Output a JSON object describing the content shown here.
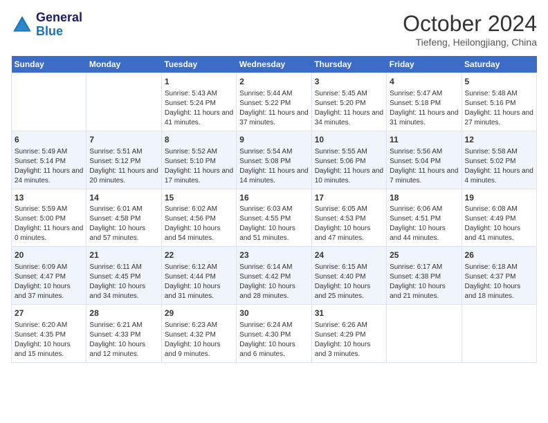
{
  "header": {
    "logo_line1": "General",
    "logo_line2": "Blue",
    "month": "October 2024",
    "location": "Tiefeng, Heilongjiang, China"
  },
  "weekdays": [
    "Sunday",
    "Monday",
    "Tuesday",
    "Wednesday",
    "Thursday",
    "Friday",
    "Saturday"
  ],
  "rows": [
    [
      {
        "day": "",
        "content": ""
      },
      {
        "day": "",
        "content": ""
      },
      {
        "day": "1",
        "content": "Sunrise: 5:43 AM\nSunset: 5:24 PM\nDaylight: 11 hours and 41 minutes."
      },
      {
        "day": "2",
        "content": "Sunrise: 5:44 AM\nSunset: 5:22 PM\nDaylight: 11 hours and 37 minutes."
      },
      {
        "day": "3",
        "content": "Sunrise: 5:45 AM\nSunset: 5:20 PM\nDaylight: 11 hours and 34 minutes."
      },
      {
        "day": "4",
        "content": "Sunrise: 5:47 AM\nSunset: 5:18 PM\nDaylight: 11 hours and 31 minutes."
      },
      {
        "day": "5",
        "content": "Sunrise: 5:48 AM\nSunset: 5:16 PM\nDaylight: 11 hours and 27 minutes."
      }
    ],
    [
      {
        "day": "6",
        "content": "Sunrise: 5:49 AM\nSunset: 5:14 PM\nDaylight: 11 hours and 24 minutes."
      },
      {
        "day": "7",
        "content": "Sunrise: 5:51 AM\nSunset: 5:12 PM\nDaylight: 11 hours and 20 minutes."
      },
      {
        "day": "8",
        "content": "Sunrise: 5:52 AM\nSunset: 5:10 PM\nDaylight: 11 hours and 17 minutes."
      },
      {
        "day": "9",
        "content": "Sunrise: 5:54 AM\nSunset: 5:08 PM\nDaylight: 11 hours and 14 minutes."
      },
      {
        "day": "10",
        "content": "Sunrise: 5:55 AM\nSunset: 5:06 PM\nDaylight: 11 hours and 10 minutes."
      },
      {
        "day": "11",
        "content": "Sunrise: 5:56 AM\nSunset: 5:04 PM\nDaylight: 11 hours and 7 minutes."
      },
      {
        "day": "12",
        "content": "Sunrise: 5:58 AM\nSunset: 5:02 PM\nDaylight: 11 hours and 4 minutes."
      }
    ],
    [
      {
        "day": "13",
        "content": "Sunrise: 5:59 AM\nSunset: 5:00 PM\nDaylight: 11 hours and 0 minutes."
      },
      {
        "day": "14",
        "content": "Sunrise: 6:01 AM\nSunset: 4:58 PM\nDaylight: 10 hours and 57 minutes."
      },
      {
        "day": "15",
        "content": "Sunrise: 6:02 AM\nSunset: 4:56 PM\nDaylight: 10 hours and 54 minutes."
      },
      {
        "day": "16",
        "content": "Sunrise: 6:03 AM\nSunset: 4:55 PM\nDaylight: 10 hours and 51 minutes."
      },
      {
        "day": "17",
        "content": "Sunrise: 6:05 AM\nSunset: 4:53 PM\nDaylight: 10 hours and 47 minutes."
      },
      {
        "day": "18",
        "content": "Sunrise: 6:06 AM\nSunset: 4:51 PM\nDaylight: 10 hours and 44 minutes."
      },
      {
        "day": "19",
        "content": "Sunrise: 6:08 AM\nSunset: 4:49 PM\nDaylight: 10 hours and 41 minutes."
      }
    ],
    [
      {
        "day": "20",
        "content": "Sunrise: 6:09 AM\nSunset: 4:47 PM\nDaylight: 10 hours and 37 minutes."
      },
      {
        "day": "21",
        "content": "Sunrise: 6:11 AM\nSunset: 4:45 PM\nDaylight: 10 hours and 34 minutes."
      },
      {
        "day": "22",
        "content": "Sunrise: 6:12 AM\nSunset: 4:44 PM\nDaylight: 10 hours and 31 minutes."
      },
      {
        "day": "23",
        "content": "Sunrise: 6:14 AM\nSunset: 4:42 PM\nDaylight: 10 hours and 28 minutes."
      },
      {
        "day": "24",
        "content": "Sunrise: 6:15 AM\nSunset: 4:40 PM\nDaylight: 10 hours and 25 minutes."
      },
      {
        "day": "25",
        "content": "Sunrise: 6:17 AM\nSunset: 4:38 PM\nDaylight: 10 hours and 21 minutes."
      },
      {
        "day": "26",
        "content": "Sunrise: 6:18 AM\nSunset: 4:37 PM\nDaylight: 10 hours and 18 minutes."
      }
    ],
    [
      {
        "day": "27",
        "content": "Sunrise: 6:20 AM\nSunset: 4:35 PM\nDaylight: 10 hours and 15 minutes."
      },
      {
        "day": "28",
        "content": "Sunrise: 6:21 AM\nSunset: 4:33 PM\nDaylight: 10 hours and 12 minutes."
      },
      {
        "day": "29",
        "content": "Sunrise: 6:23 AM\nSunset: 4:32 PM\nDaylight: 10 hours and 9 minutes."
      },
      {
        "day": "30",
        "content": "Sunrise: 6:24 AM\nSunset: 4:30 PM\nDaylight: 10 hours and 6 minutes."
      },
      {
        "day": "31",
        "content": "Sunrise: 6:26 AM\nSunset: 4:29 PM\nDaylight: 10 hours and 3 minutes."
      },
      {
        "day": "",
        "content": ""
      },
      {
        "day": "",
        "content": ""
      }
    ]
  ]
}
